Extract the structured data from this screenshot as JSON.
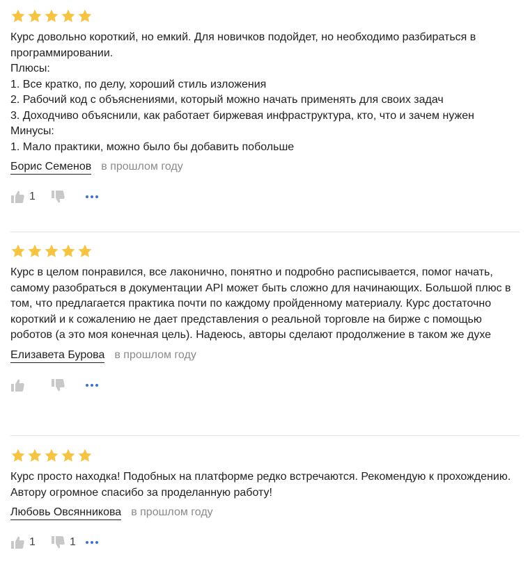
{
  "colors": {
    "star": "#f6c443",
    "author_underline": "#1f1f1f",
    "date": "#8a8a8a",
    "more_dots": "#3b6fd6",
    "vote_icon": "#c8c8c8"
  },
  "reviews": [
    {
      "rating": 5,
      "text": "Курс довольно короткий, но емкий. Для новичков подойдет, но необходимо разбираться в программировании.\nПлюсы:\n1. Все кратко, по делу, хороший стиль изложения\n2. Рабочий код с объяснениями, который можно начать применять для своих задач\n3. Доходчиво объяснили, как работает биржевая инфраструктура, кто, что и зачем нужен\nМинусы:\n1. Мало практики, можно было бы добавить побольше",
      "author": "Борис Семенов",
      "date": "в прошлом году",
      "likes": "1",
      "dislikes": ""
    },
    {
      "rating": 5,
      "text": "Курс в целом понравился, все лаконично, понятно и подробно расписывается, помог начать, самому разобраться в документации API может быть сложно для начинающих. Большой плюс в том, что предлагается практика почти по каждому пройденному материалу. Курс достаточно короткий и к сожалению не дает представления о реальной торговле на бирже с помощью роботов (а это моя конечная цель). Надеюсь, авторы сделают продолжение в таком же духе",
      "author": "Елизавета Бурова",
      "date": "в прошлом году",
      "likes": "",
      "dislikes": ""
    },
    {
      "rating": 5,
      "text": "Курс просто находка! Подобных на платформе редко встречаются. Рекомендую к прохождению. Автору огромное спасибо за проделанную работу!",
      "author": "Любовь Овсянникова",
      "date": "в прошлом году",
      "likes": "1",
      "dislikes": "1"
    }
  ]
}
